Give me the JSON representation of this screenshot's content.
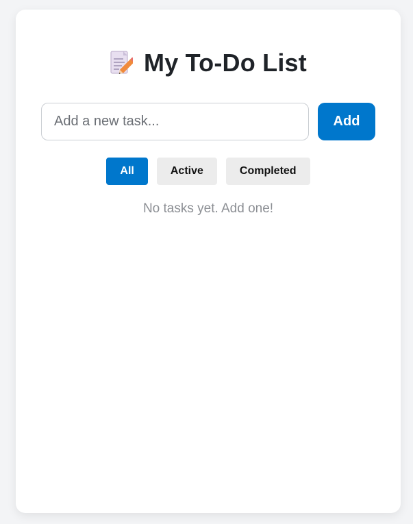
{
  "app": {
    "title": "My To-Do List",
    "title_icon": "memo-icon"
  },
  "new_task": {
    "placeholder": "Add a new task...",
    "value": "",
    "add_label": "Add"
  },
  "filters": {
    "all_label": "All",
    "active_label": "Active",
    "completed_label": "Completed",
    "selected": "All"
  },
  "tasks": [],
  "empty_message": "No tasks yet. Add one!",
  "colors": {
    "accent": "#0077cc",
    "background": "#f3f4f6",
    "card": "#ffffff"
  }
}
